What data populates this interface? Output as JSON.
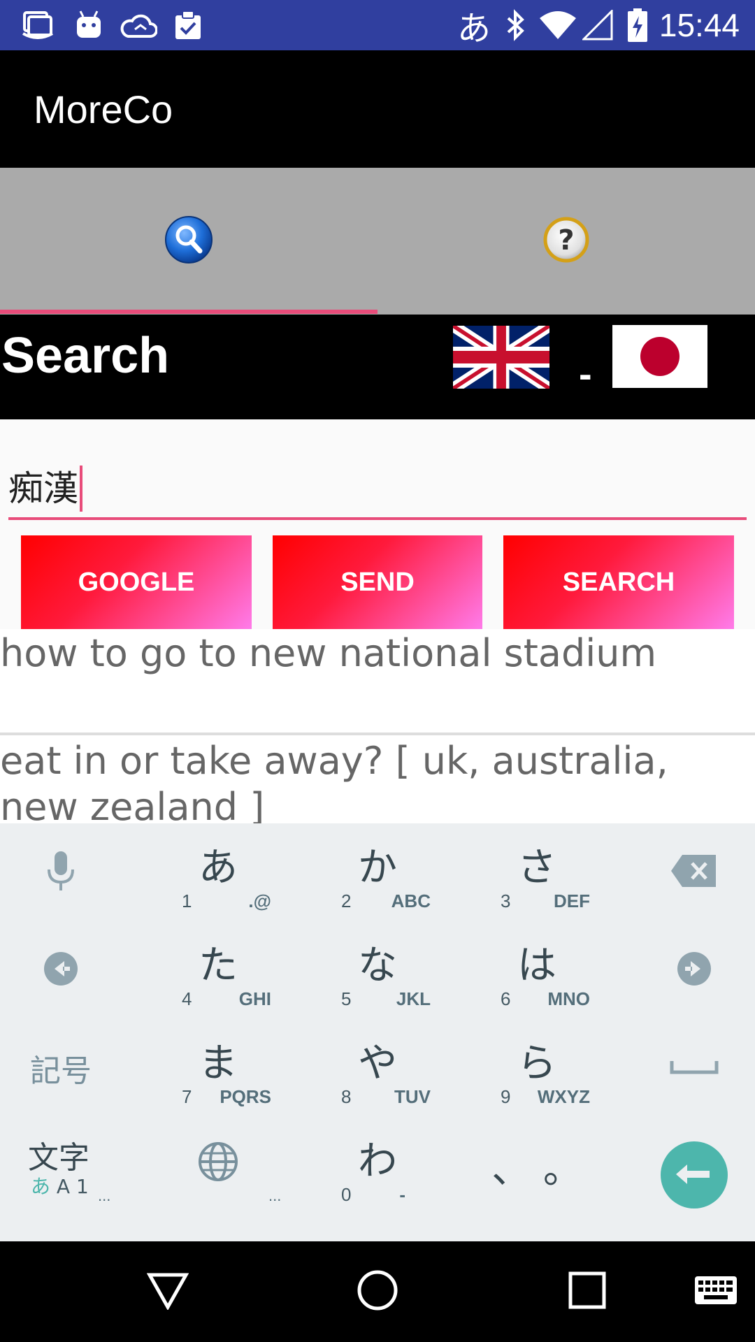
{
  "status_bar": {
    "time": "15:44",
    "ime_indicator": "あ",
    "icons": [
      "files-icon",
      "android-icon",
      "cloud-sync-icon",
      "clipboard-check-icon",
      "bluetooth-icon",
      "wifi-icon",
      "signal-icon",
      "battery-charging-icon"
    ]
  },
  "app_bar": {
    "title": "MoreCo"
  },
  "tabs": [
    {
      "name": "search",
      "icon": "search-icon",
      "selected": true
    },
    {
      "name": "help",
      "icon": "question-icon",
      "selected": false
    }
  ],
  "search_header": {
    "title": "Search",
    "separator": "-",
    "source_flag": "uk-flag-icon",
    "target_flag": "japan-flag-icon"
  },
  "search_input": {
    "value": "痴漢"
  },
  "buttons": {
    "google": "GOOGLE",
    "send": "SEND",
    "search": "SEARCH"
  },
  "history": [
    "how to go to new national stadium",
    "eat in or take away? [ uk, australia, new zealand ]"
  ],
  "keyboard": {
    "rows": [
      [
        {
          "kana": "あ",
          "num": "1",
          "alpha": ".@"
        },
        {
          "kana": "か",
          "num": "2",
          "alpha": "ABC"
        },
        {
          "kana": "さ",
          "num": "3",
          "alpha": "DEF"
        }
      ],
      [
        {
          "kana": "た",
          "num": "4",
          "alpha": "GHI"
        },
        {
          "kana": "な",
          "num": "5",
          "alpha": "JKL"
        },
        {
          "kana": "は",
          "num": "6",
          "alpha": "MNO"
        }
      ],
      [
        {
          "kana": "ま",
          "num": "7",
          "alpha": "PQRS"
        },
        {
          "kana": "や",
          "num": "8",
          "alpha": "TUV"
        },
        {
          "kana": "ら",
          "num": "9",
          "alpha": "WXYZ"
        }
      ],
      [
        {
          "kana": "わ",
          "num": "0",
          "alpha": "-"
        }
      ]
    ],
    "punct": "、 。",
    "kigou": "記号",
    "moji": "文字",
    "moji_sub_kana": "あ",
    "moji_sub_alpha": "A 1",
    "ellipsis": "...",
    "accent": "#4DB6AC"
  },
  "colors": {
    "status_bar": "#303F9F",
    "accent_pink": "#E84C7A",
    "tab_bg": "#AAAAAA"
  }
}
